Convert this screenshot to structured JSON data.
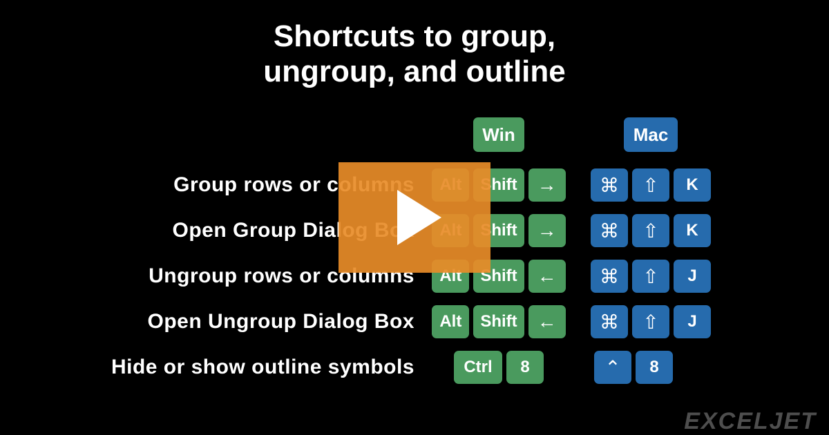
{
  "title_line1": "Shortcuts to group,",
  "title_line2": "ungroup, and outline",
  "headers": {
    "win": "Win",
    "mac": "Mac"
  },
  "rows": [
    {
      "label": "Group rows or columns",
      "win": [
        "Alt",
        "Shift",
        "→"
      ],
      "mac": [
        "⌘",
        "⇧",
        "K"
      ]
    },
    {
      "label": "Open Group Dialog Box",
      "win": [
        "Alt",
        "Shift",
        "→"
      ],
      "mac": [
        "⌘",
        "⇧",
        "K"
      ]
    },
    {
      "label": "Ungroup rows or columns",
      "win": [
        "Alt",
        "Shift",
        "←"
      ],
      "mac": [
        "⌘",
        "⇧",
        "J"
      ]
    },
    {
      "label": "Open Ungroup Dialog Box",
      "win": [
        "Alt",
        "Shift",
        "←"
      ],
      "mac": [
        "⌘",
        "⇧",
        "J"
      ]
    },
    {
      "label": "Hide or show outline symbols",
      "win": [
        "Ctrl",
        "8"
      ],
      "mac": [
        "⌃",
        "8"
      ]
    }
  ],
  "brand": "EXCELJET"
}
